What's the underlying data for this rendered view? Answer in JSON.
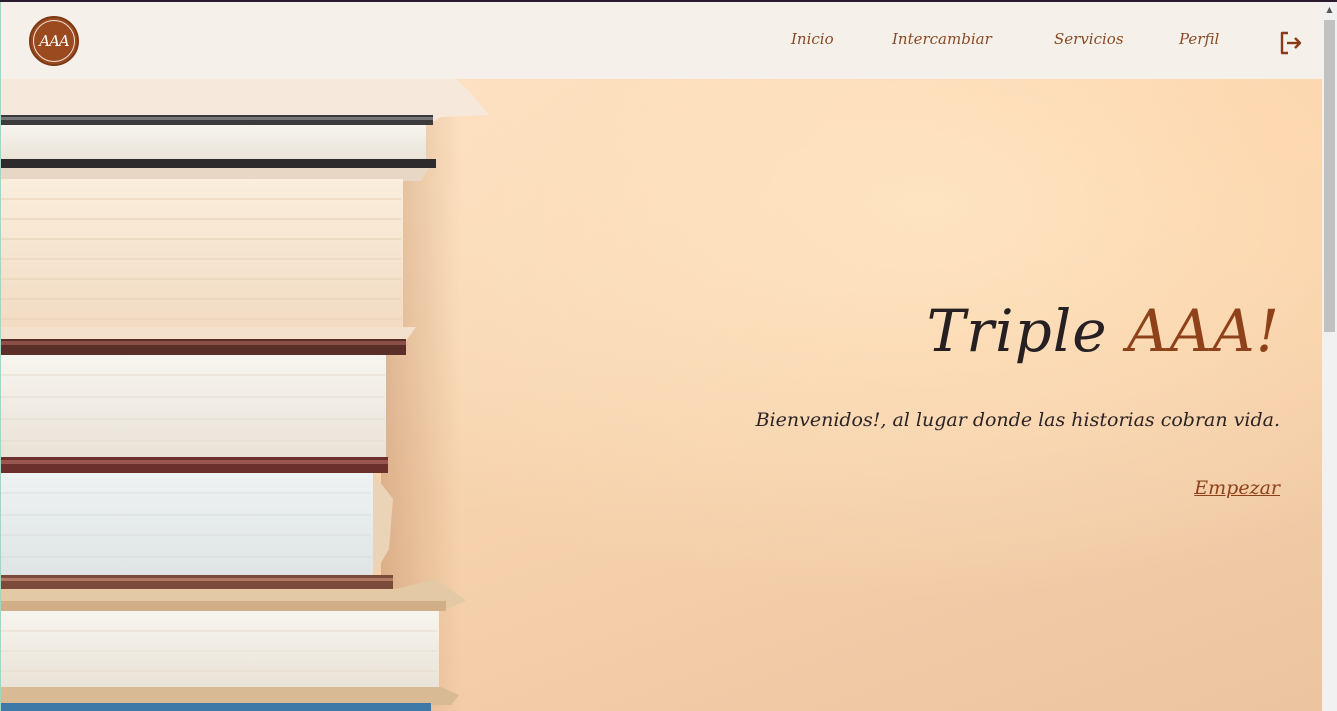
{
  "brand": {
    "logo_text": "AAA",
    "logo_color": "#9a4a1e"
  },
  "nav": {
    "items": [
      {
        "label": "Inicio"
      },
      {
        "label": "Intercambiar"
      },
      {
        "label": "Servicios"
      },
      {
        "label": "Perfil"
      }
    ],
    "logout_icon": "logout-icon"
  },
  "hero": {
    "title_main": "Triple",
    "title_accent": "AAA!",
    "subtitle": "Bienvenidos!, al lugar donde las historias cobran vida.",
    "cta_label": "Empezar"
  },
  "colors": {
    "accent": "#8f421a",
    "navbar_bg": "#f5f1ea",
    "text_dark": "#262023"
  }
}
